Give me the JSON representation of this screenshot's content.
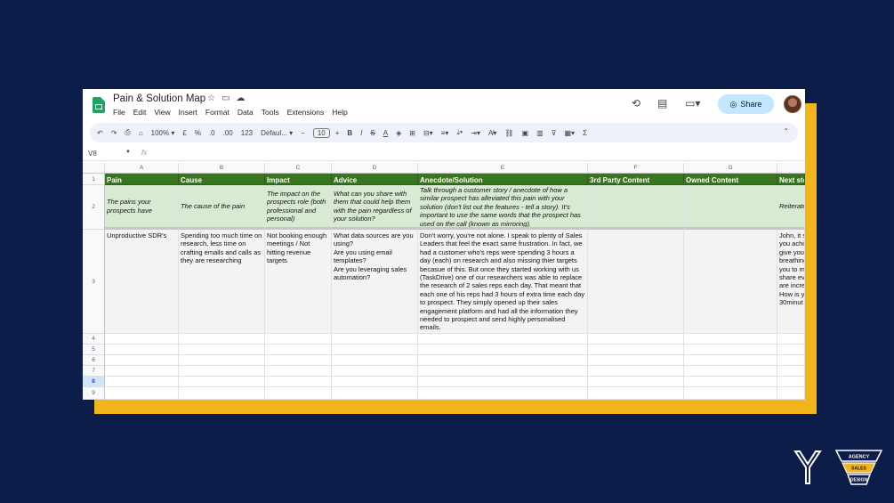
{
  "doc": {
    "title": "Pain & Solution Map",
    "menu": [
      "File",
      "Edit",
      "View",
      "Insert",
      "Format",
      "Data",
      "Tools",
      "Extensions",
      "Help"
    ],
    "share_label": "Share"
  },
  "toolbar": {
    "zoom": "100%",
    "currency": "£",
    "percent": "%",
    "dec_decrease": ".0",
    "dec_increase": ".00",
    "number_format": "123",
    "font": "Defaul...",
    "font_size": "10",
    "bold": "B",
    "italic": "I",
    "strike": "S",
    "text_color": "A",
    "sum": "Σ"
  },
  "formula_bar": {
    "name_box": "V8",
    "fx": "fx"
  },
  "columns": [
    "A",
    "B",
    "C",
    "D",
    "E",
    "F",
    "G"
  ],
  "rows": [
    "1",
    "2",
    "3",
    "4",
    "5",
    "6",
    "7",
    "8",
    "9"
  ],
  "headers": {
    "pain": "Pain",
    "cause": "Cause",
    "impact": "Impact",
    "advice": "Advice",
    "anecdote": "Anecdote/Solution",
    "third_party": "3rd Party Content",
    "owned": "Owned Content",
    "next_steps": "Next ste"
  },
  "guide": {
    "pain": "The pains your prospects have",
    "cause": "The cause of the pain",
    "impact": "The impact on the prospects role (both professional and personal)",
    "advice": "What can you share with them that could help them with the pain regardless of your solution?",
    "anecdote": "Talk through a customer story / anecdote of how a similar prospect has alleviated this pain with your solution (don't list out the features - tell a story). It's important to use the same words that the prospect has used on the call (known as mirroring).",
    "third_party": "",
    "owned": "",
    "next_steps": "Reiterate book the"
  },
  "example": {
    "pain": "Unproductive SDR's",
    "cause": "Spending too much time on research, less time on crafting emails and calls as they are researching",
    "impact": "Not booking enough meetings / Not hitting revenue targets",
    "advice": "What data sources are you using?\nAre you using email templates?\nAre you leveraging sales automation?",
    "anecdote": "Don't worry, you're not alone. I speak to plenty of Sales Leaders that feel the exact same frustration. In fact, we had a customer who's reps were spending 3 hours a day (each) on research and also missing thier targets becasue of this. But once they started working with us (TaskDrive) one of our researchers was able to replace the research of 2 sales reps each day. That meant that each one of his reps had 3 hours of extra time each day to prospect. They simply opened up their sales engagement platform and had all the information they needed to prospect and send highly personalised emails.",
    "third_party": "",
    "owned": "",
    "next_steps": "John, it s\nyou achi\ngive you\nbreathing\nyou to m\nshare ev\nare incre\nHow is y\n30minut"
  },
  "brand": {
    "agency_line1": "AGENCY",
    "agency_line2": "SALES",
    "agency_line3": "DESIGN"
  },
  "colors": {
    "background": "#0c1d4a",
    "frame_accent": "#f4b51b",
    "header_green": "#38761d",
    "guide_green": "#d9ead3",
    "share_blue": "#c2e7ff"
  }
}
